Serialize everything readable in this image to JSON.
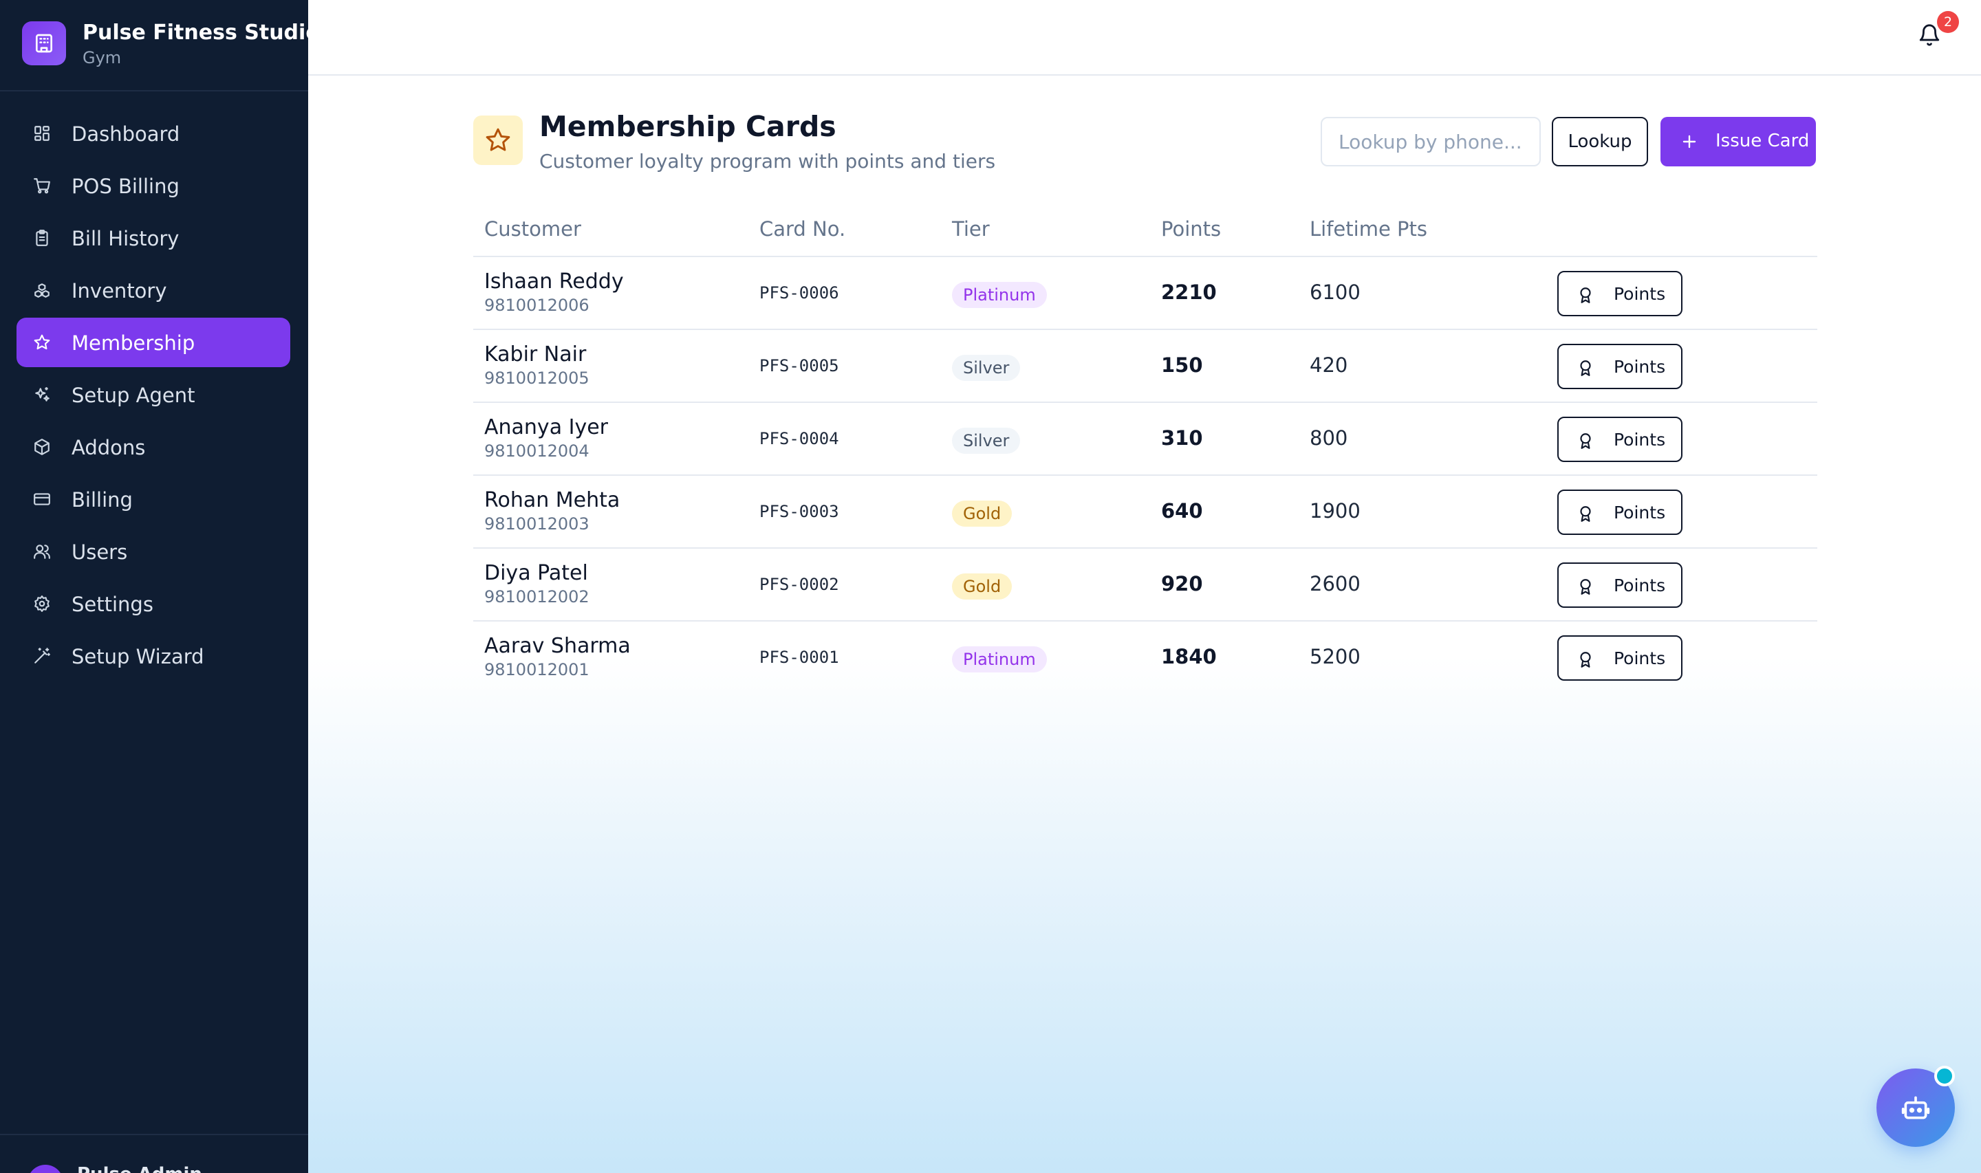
{
  "brand": {
    "name": "Pulse Fitness Studio",
    "subtitle": "Gym",
    "icon": "building-icon"
  },
  "sidebar": {
    "items": [
      {
        "label": "Dashboard",
        "icon": "grid-icon",
        "active": false
      },
      {
        "label": "POS Billing",
        "icon": "cart-icon",
        "active": false
      },
      {
        "label": "Bill History",
        "icon": "clipboard-icon",
        "active": false
      },
      {
        "label": "Inventory",
        "icon": "boxes-icon",
        "active": false
      },
      {
        "label": "Membership",
        "icon": "star-icon",
        "active": true
      },
      {
        "label": "Setup Agent",
        "icon": "sparkles-icon",
        "active": false
      },
      {
        "label": "Addons",
        "icon": "package-icon",
        "active": false
      },
      {
        "label": "Billing",
        "icon": "credit-card-icon",
        "active": false
      },
      {
        "label": "Users",
        "icon": "users-icon",
        "active": false
      },
      {
        "label": "Settings",
        "icon": "gear-icon",
        "active": false
      },
      {
        "label": "Setup Wizard",
        "icon": "wand-icon",
        "active": false
      }
    ],
    "footer": {
      "user_name": "Pulse Admin"
    }
  },
  "topbar": {
    "notification_count": "2"
  },
  "page": {
    "title": "Membership Cards",
    "subtitle": "Customer loyalty program with points and tiers",
    "lookup_placeholder": "Lookup by phone...",
    "lookup_label": "Lookup",
    "issue_label": "Issue Card"
  },
  "table": {
    "headers": {
      "customer": "Customer",
      "card_no": "Card No.",
      "tier": "Tier",
      "points": "Points",
      "lifetime": "Lifetime Pts"
    },
    "action_label": "Points",
    "rows": [
      {
        "name": "Ishaan Reddy",
        "phone": "9810012006",
        "card": "PFS-0006",
        "tier": "Platinum",
        "points": "2210",
        "lifetime": "6100"
      },
      {
        "name": "Kabir Nair",
        "phone": "9810012005",
        "card": "PFS-0005",
        "tier": "Silver",
        "points": "150",
        "lifetime": "420"
      },
      {
        "name": "Ananya Iyer",
        "phone": "9810012004",
        "card": "PFS-0004",
        "tier": "Silver",
        "points": "310",
        "lifetime": "800"
      },
      {
        "name": "Rohan Mehta",
        "phone": "9810012003",
        "card": "PFS-0003",
        "tier": "Gold",
        "points": "640",
        "lifetime": "1900"
      },
      {
        "name": "Diya Patel",
        "phone": "9810012002",
        "card": "PFS-0002",
        "tier": "Gold",
        "points": "920",
        "lifetime": "2600"
      },
      {
        "name": "Aarav Sharma",
        "phone": "9810012001",
        "card": "PFS-0001",
        "tier": "Platinum",
        "points": "1840",
        "lifetime": "5200"
      }
    ]
  },
  "colors": {
    "sidebar_bg": "#0f1d32",
    "accent": "#7c3aed",
    "tier_platinum": "#9333ea",
    "tier_silver": "#475569",
    "tier_gold": "#a16207",
    "badge": "#ef4444"
  }
}
